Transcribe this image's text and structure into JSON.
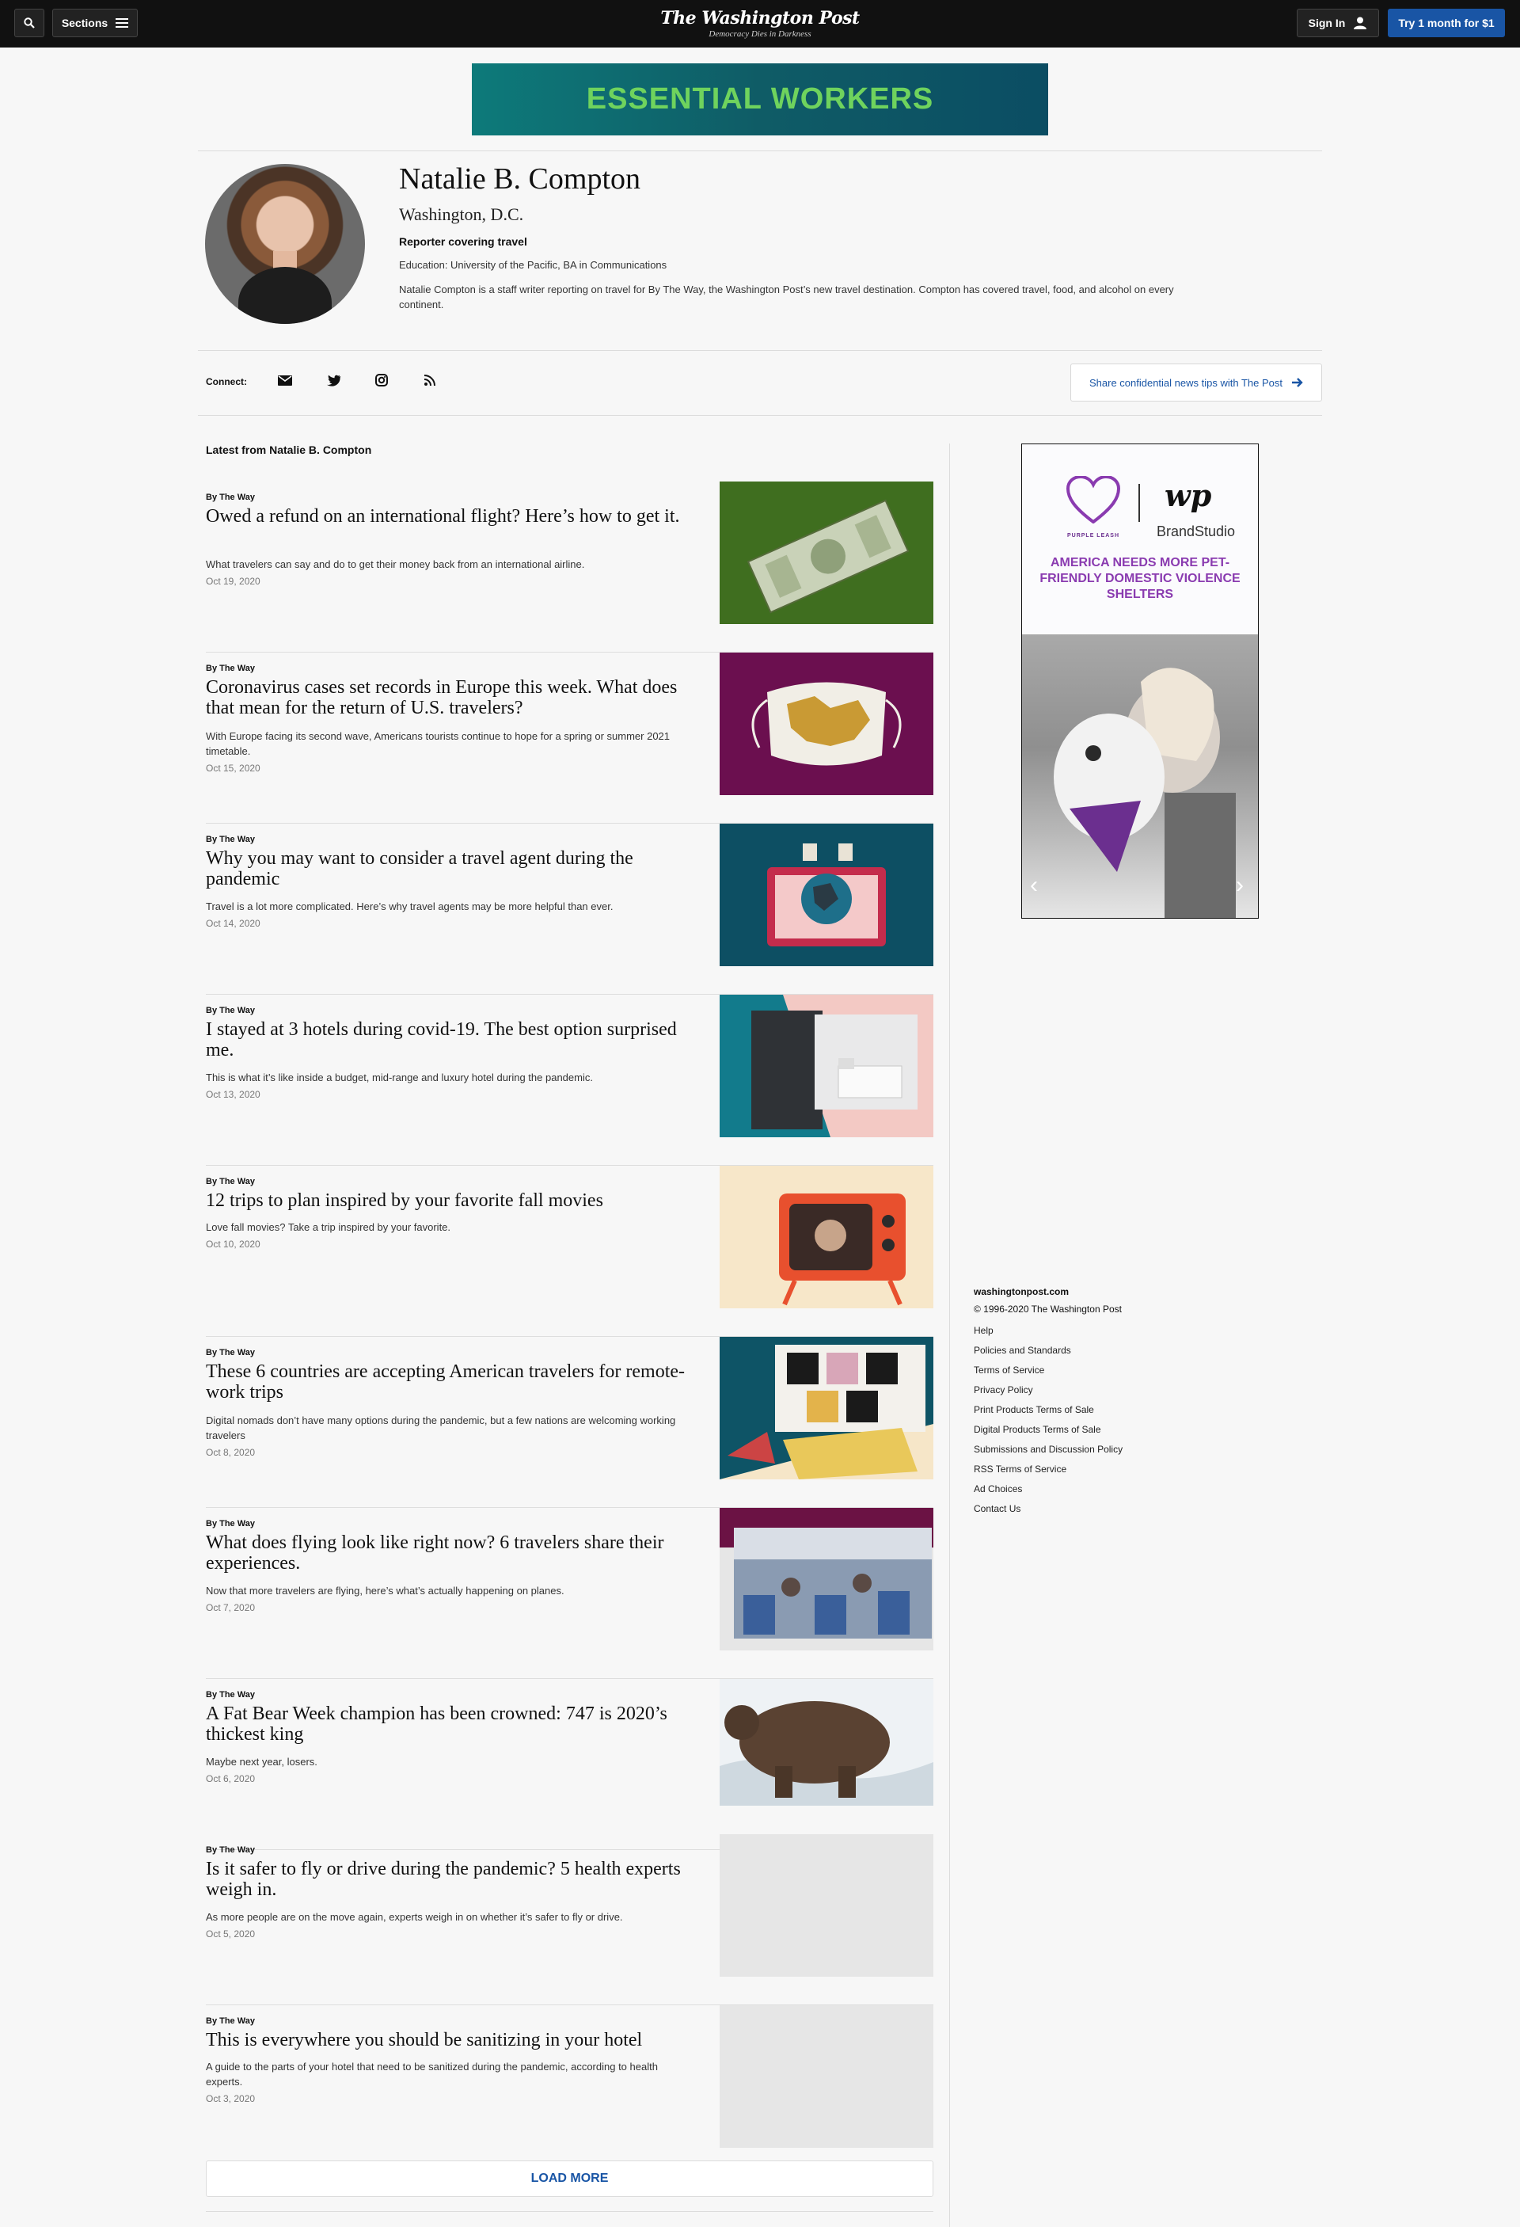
{
  "nav": {
    "sections_label": "Sections",
    "logo_name": "The Washington Post",
    "logo_tagline": "Democracy Dies in Darkness",
    "signin_label": "Sign In",
    "try_label": "Try 1 month for $1"
  },
  "banner": {
    "text": "ESSENTIAL WORKERS"
  },
  "profile": {
    "name": "Natalie B. Compton",
    "location": "Washington, D.C.",
    "role": "Reporter covering travel",
    "education": "Education: University of the Pacific, BA in Communications",
    "bio": "Natalie Compton is a staff writer reporting on travel for By The Way, the Washington Post’s new travel destination. Compton has covered travel, food, and alcohol on every continent."
  },
  "connect": {
    "label": "Connect:",
    "icons": [
      "email-icon",
      "twitter-icon",
      "instagram-icon",
      "rss-icon"
    ],
    "tips_label": "Share confidential news tips with The Post"
  },
  "latest_label": "Latest from Natalie B. Compton",
  "articles": [
    {
      "kicker": "By The Way",
      "headline": "Owed a refund on an international flight? Here’s how to get it.",
      "blurb": "What travelers can say and do to get their money back from an international airline.",
      "date": "Oct 19, 2020",
      "thumb_color": "#3f6e1f"
    },
    {
      "kicker": "By The Way",
      "headline": "Coronavirus cases set records in Europe this week. What does that mean for the return of U.S. travelers?",
      "blurb": "With Europe facing its second wave, Americans tourists continue to hope for a spring or summer 2021 timetable.",
      "date": "Oct 15, 2020",
      "thumb_color": "#6b0f4f"
    },
    {
      "kicker": "By The Way",
      "headline": "Why you may want to consider a travel agent during the pandemic",
      "blurb": "Travel is a lot more complicated. Here’s why travel agents may be more helpful than ever.",
      "date": "Oct 14, 2020",
      "thumb_color": "#0d4f63"
    },
    {
      "kicker": "By The Way",
      "headline": "I stayed at 3 hotels during covid-19. The best option surprised me.",
      "blurb": "This is what it’s like inside a budget, mid-range and luxury hotel during the pandemic.",
      "date": "Oct 13, 2020",
      "thumb_color": "#f3c9c4"
    },
    {
      "kicker": "By The Way",
      "headline": "12 trips to plan inspired by your favorite fall movies",
      "blurb": "Love fall movies? Take a trip inspired by your favorite.",
      "date": "Oct 10, 2020",
      "thumb_color": "#f7e7c9"
    },
    {
      "kicker": "By The Way",
      "headline": "These 6 countries are accepting American travelers for remote-work trips",
      "blurb": "Digital nomads don’t have many options during the pandemic, but a few nations are welcoming working travelers",
      "date": "Oct 8, 2020",
      "thumb_color": "#0e5466"
    },
    {
      "kicker": "By The Way",
      "headline": "What does flying look like right now? 6 travelers share their experiences.",
      "blurb": "Now that more travelers are flying, here’s what’s actually happening on planes.",
      "date": "Oct 7, 2020",
      "thumb_color": "#6b1244"
    },
    {
      "kicker": "By The Way",
      "headline": "A Fat Bear Week champion has been crowned: 747 is 2020’s thickest king",
      "blurb": "Maybe next year, losers.",
      "date": "Oct 6, 2020",
      "thumb_color": "#6a5646"
    },
    {
      "kicker": "By The Way",
      "headline": "Is it safer to fly or drive during the pandemic? 5 health experts weigh in.",
      "blurb": "As more people are on the move again, experts weigh in on whether it’s safer to fly or drive.",
      "date": "Oct 5, 2020",
      "thumb_color": "#e6e6e6"
    },
    {
      "kicker": "By The Way",
      "headline": "This is everywhere you should be sanitizing in your hotel",
      "blurb": "A guide to the parts of your hotel that need to be sanitized during the pandemic, according to health experts.",
      "date": "Oct 3, 2020",
      "thumb_color": "#e6e6e6"
    }
  ],
  "load_more_label": "LOAD MORE",
  "side_ad": {
    "brand_left": "PURPLE LEASH",
    "brand_right": "BrandStudio",
    "headline": "AMERICA NEEDS MORE PET-FRIENDLY DOMESTIC VIOLENCE SHELTERS"
  },
  "footer": {
    "site": "washingtonpost.com",
    "copyright": "© 1996-2020 The Washington Post",
    "links": [
      "Help",
      "Policies and Standards",
      "Terms of Service",
      "Privacy Policy",
      "Print Products Terms of Sale",
      "Digital Products Terms of Sale",
      "Submissions and Discussion Policy",
      "RSS Terms of Service",
      "Ad Choices",
      "Contact Us"
    ]
  }
}
